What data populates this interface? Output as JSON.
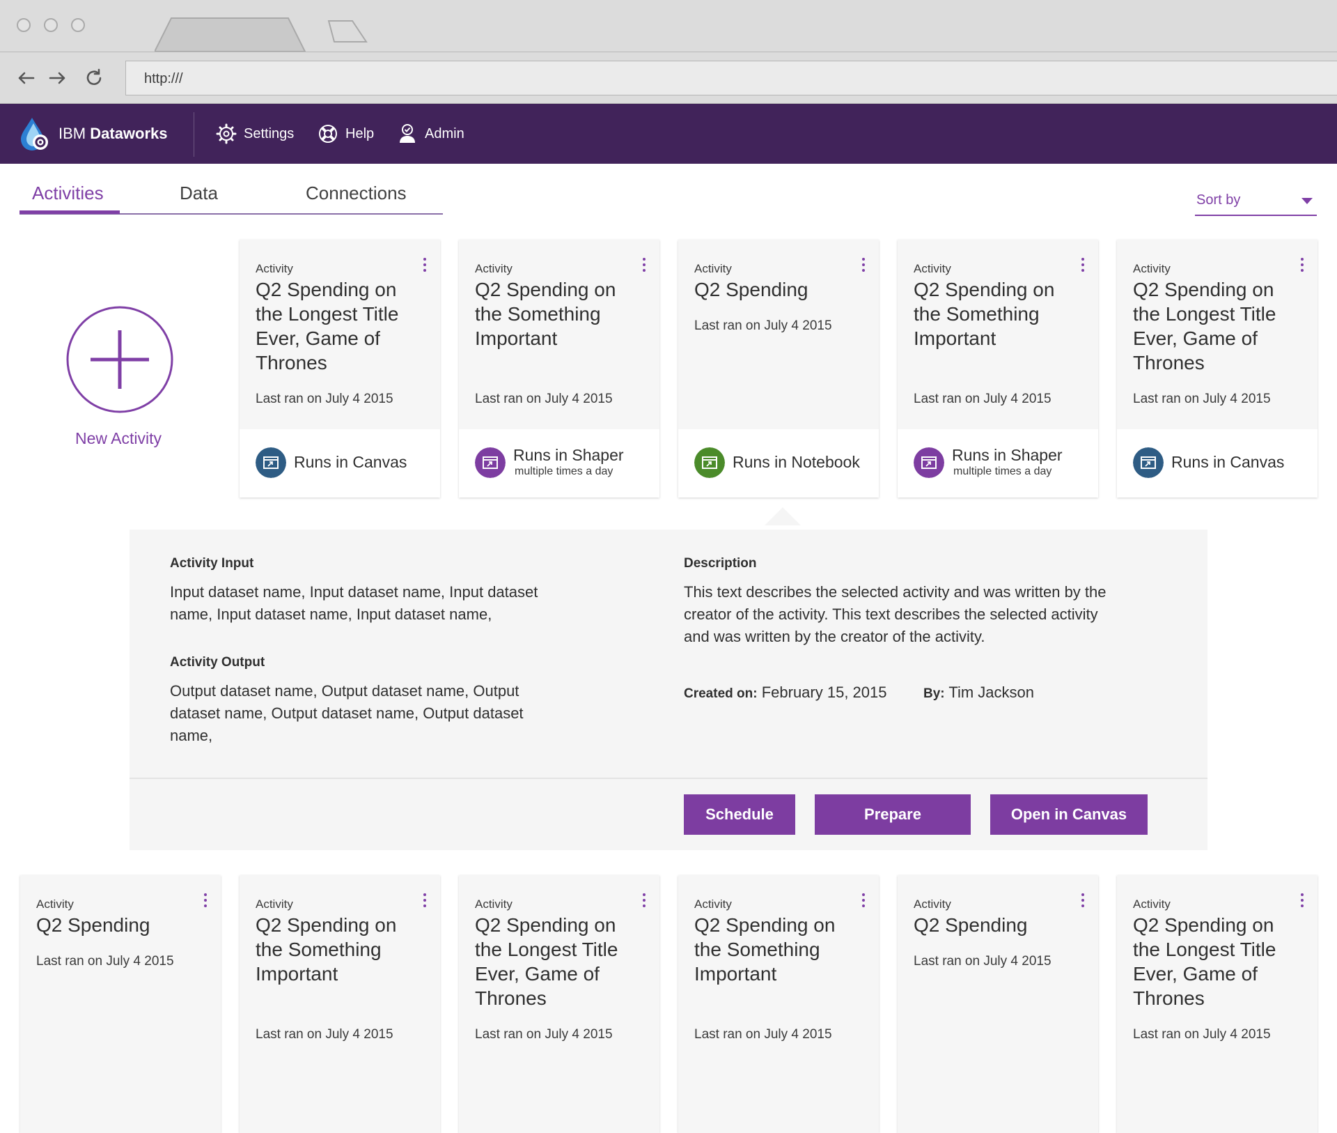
{
  "browser": {
    "url": "http:///"
  },
  "app": {
    "brand_prefix": "IBM",
    "brand_name": "Dataworks",
    "nav": [
      {
        "label": "Settings",
        "icon": "gear-icon"
      },
      {
        "label": "Help",
        "icon": "lifebuoy-icon"
      },
      {
        "label": "Admin",
        "icon": "admin-user-icon"
      }
    ]
  },
  "tabs": [
    "Activities",
    "Data",
    "Connections"
  ],
  "active_tab": "Activities",
  "sort": {
    "label": "Sort by"
  },
  "new_activity": {
    "label": "New Activity"
  },
  "colors": {
    "accent": "#7f3fa6",
    "header": "#41235a",
    "canvas": "#2e5c84",
    "shaper": "#7d3da1",
    "notebook": "#4b8b2a"
  },
  "cards_row1": [
    {
      "type": "Activity",
      "title": "Q2 Spending on the Longest Title Ever, Game of Thrones",
      "last_ran": "Last ran on July 4 2015",
      "runs": "Runs in Canvas",
      "runs_sub": "",
      "kind": "canvas"
    },
    {
      "type": "Activity",
      "title": "Q2 Spending on the Something Important",
      "last_ran": "Last ran on July 4 2015",
      "runs": "Runs in Shaper",
      "runs_sub": "multiple times a day",
      "kind": "shaper"
    },
    {
      "type": "Activity",
      "title": "Q2 Spending",
      "last_ran": "Last ran on July 4 2015",
      "runs": "Runs in Notebook",
      "runs_sub": "",
      "kind": "notebook"
    },
    {
      "type": "Activity",
      "title": "Q2 Spending on the Something Important",
      "last_ran": "Last ran on July 4 2015",
      "runs": "Runs in Shaper",
      "runs_sub": "multiple times a day",
      "kind": "shaper"
    },
    {
      "type": "Activity",
      "title": "Q2 Spending on the Longest Title Ever, Game of Thrones",
      "last_ran": "Last ran on July 4 2015",
      "runs": "Runs in Canvas",
      "runs_sub": "",
      "kind": "canvas"
    }
  ],
  "detail": {
    "input_heading": "Activity Input",
    "input_text": "Input dataset name, Input dataset name, Input dataset name, Input dataset name, Input dataset name,",
    "output_heading": "Activity Output",
    "output_text": "Output dataset name, Output dataset name, Output dataset name, Output dataset name, Output dataset name,",
    "description_heading": "Description",
    "description_text": "This text describes the selected activity and was written by the creator of the activity.  This text describes the selected activity and was written by the creator of the activity.",
    "created_label": "Created on:",
    "created_value": "February 15, 2015",
    "by_label": "By:",
    "by_value": "Tim Jackson",
    "buttons": [
      "Schedule",
      "Prepare",
      "Open in Canvas"
    ]
  },
  "cards_row2": [
    {
      "type": "Activity",
      "title": "Q2 Spending",
      "last_ran": "Last ran on July 4 2015"
    },
    {
      "type": "Activity",
      "title": "Q2 Spending on the Something Important",
      "last_ran": "Last ran on July 4 2015"
    },
    {
      "type": "Activity",
      "title": "Q2 Spending on the Longest Title Ever, Game of Thrones",
      "last_ran": "Last ran on July 4 2015"
    },
    {
      "type": "Activity",
      "title": "Q2 Spending on the Something Important",
      "last_ran": "Last ran on July 4 2015"
    },
    {
      "type": "Activity",
      "title": "Q2 Spending",
      "last_ran": "Last ran on July 4 2015"
    },
    {
      "type": "Activity",
      "title": "Q2 Spending on the Longest Title Ever, Game of Thrones",
      "last_ran": "Last ran on July 4 2015"
    }
  ]
}
